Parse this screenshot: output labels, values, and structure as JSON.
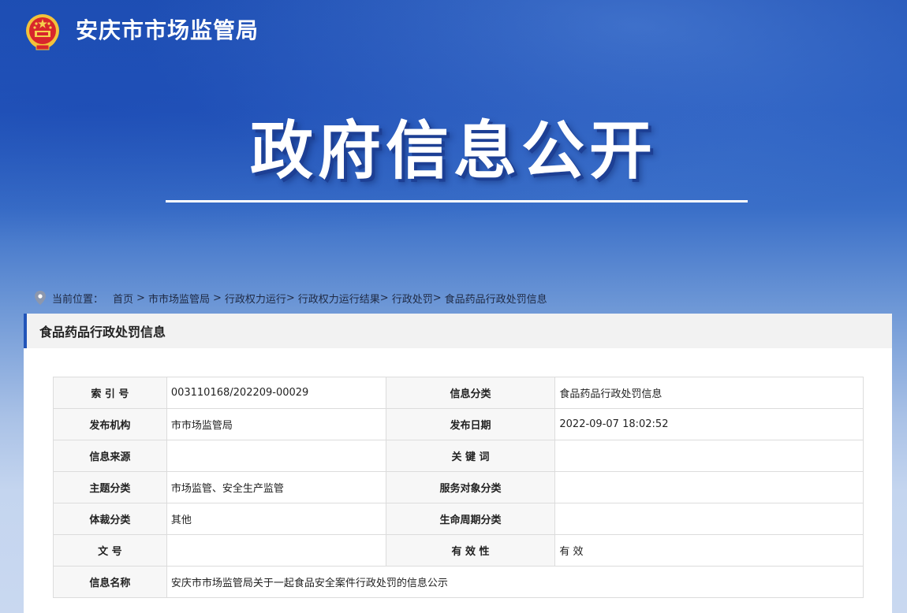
{
  "header": {
    "site_title": "安庆市市场监管局",
    "emblem_icon": "national-emblem-icon"
  },
  "banner": {
    "title": "政府信息公开"
  },
  "breadcrumb": {
    "prefix": "当前位置：",
    "items": [
      "首页",
      "市市场监管局",
      "行政权力运行",
      "行政权力运行结果",
      "行政处罚",
      "食品药品行政处罚信息"
    ],
    "separator": ">"
  },
  "panel": {
    "heading": "食品药品行政处罚信息"
  },
  "meta": {
    "index_no_label": "索 引 号",
    "index_no": "003110168/202209-00029",
    "category_label": "信息分类",
    "category": "食品药品行政处罚信息",
    "publisher_label": "发布机构",
    "publisher": "市市场监管局",
    "publish_date_label": "发布日期",
    "publish_date": "2022-09-07 18:02:52",
    "source_label": "信息来源",
    "source": "",
    "keywords_label": "关 键 词",
    "keywords": "",
    "topic_label": "主题分类",
    "topic": "市场监管、安全生产监管",
    "service_target_label": "服务对象分类",
    "service_target": "",
    "genre_label": "体裁分类",
    "genre": "其他",
    "lifecycle_label": "生命周期分类",
    "lifecycle": "",
    "doc_no_label": "文 号",
    "doc_no": "",
    "validity_label": "有 效 性",
    "validity": "有 效",
    "name_label": "信息名称",
    "name": "安庆市市场监管局关于一起食品安全案件行政处罚的信息公示"
  },
  "colors": {
    "accent": "#2154b8",
    "header_bg_top": "#1e4fb4",
    "label_cell_bg": "#f7f7f7"
  }
}
